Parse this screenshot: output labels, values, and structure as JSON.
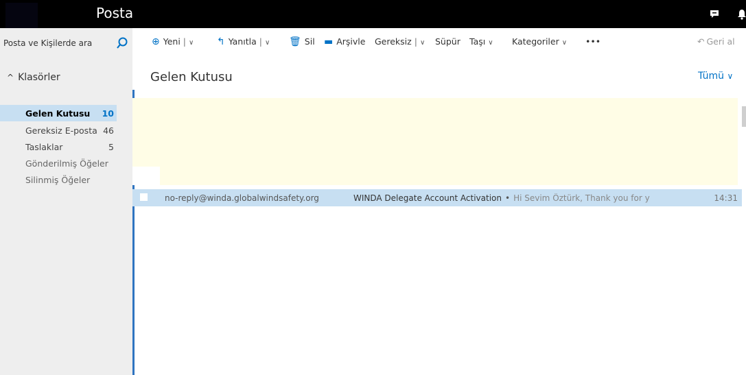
{
  "app": {
    "title": "Posta"
  },
  "search": {
    "placeholder": "Posta ve Kişilerde ara"
  },
  "folders": {
    "header": "Klasörler",
    "items": [
      {
        "label": "Gelen Kutusu",
        "count": "10"
      },
      {
        "label": "Gereksiz E-posta",
        "count": "46"
      },
      {
        "label": "Taslaklar",
        "count": "5"
      },
      {
        "label": "Gönderilmiş Öğeler",
        "count": ""
      },
      {
        "label": "Silinmiş Öğeler",
        "count": ""
      }
    ]
  },
  "toolbar": {
    "new": "Yeni",
    "reply": "Yanıtla",
    "delete": "Sil",
    "archive": "Arşivle",
    "junk": "Gereksiz",
    "sweep": "Süpür",
    "move": "Taşı",
    "categories": "Kategoriler",
    "more": "•••",
    "undo": "Geri al"
  },
  "list": {
    "title": "Gelen Kutusu",
    "filter": "Tümü",
    "messages": [
      {
        "from": "no-reply@winda.globalwindsafety.org",
        "subject": "WINDA Delegate Account Activation",
        "separator": "•",
        "preview": "Hi Sevim Öztürk, Thank you for y",
        "time": "14:31"
      }
    ]
  },
  "colors": {
    "accent": "#0072c6",
    "selected": "#c7dff2",
    "topbar": "#000000"
  }
}
